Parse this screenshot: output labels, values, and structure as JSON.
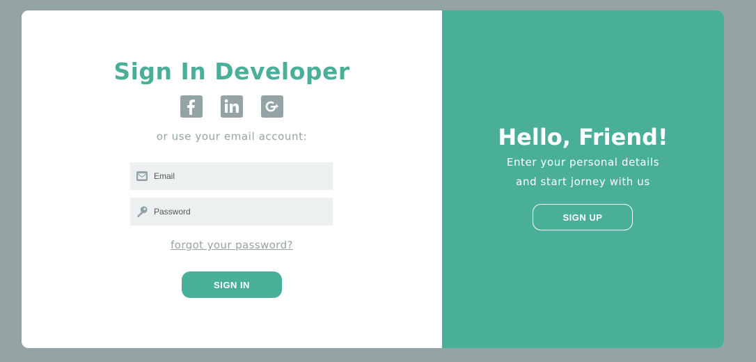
{
  "signin": {
    "title": "Sign In Developer",
    "socials": [
      {
        "icon": "facebook-icon",
        "glyph": "f"
      },
      {
        "icon": "linkedin-icon",
        "glyph": "in"
      },
      {
        "icon": "google-plus-icon",
        "glyph": "G+"
      }
    ],
    "subtitle": "or use your email account:",
    "email": {
      "placeholder": "Email",
      "value": "",
      "icon": "envelope-icon"
    },
    "password": {
      "placeholder": "Password",
      "value": "",
      "icon": "key-icon"
    },
    "forgot_label": "forgot your password?",
    "button_label": "SIGN IN"
  },
  "overlay": {
    "title": "Hello, Friend!",
    "text_line1": "Enter your personal details",
    "text_line2": "and start jorney with us",
    "button_label": "SIGN UP"
  },
  "colors": {
    "accent": "#4aaf99",
    "background": "#94a4a4",
    "field_bg": "#ecf0f1",
    "muted_text": "#95a4a4"
  }
}
